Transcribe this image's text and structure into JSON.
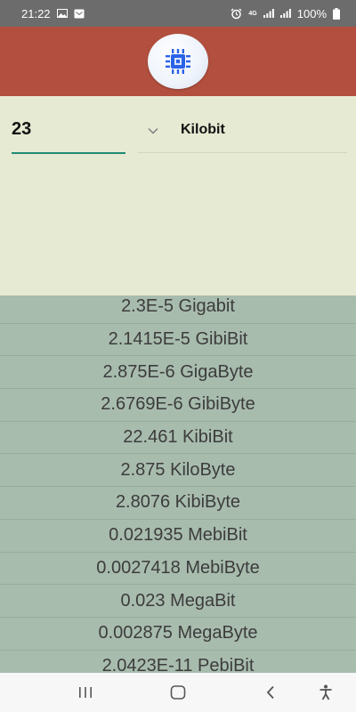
{
  "status_bar": {
    "time": "21:22",
    "network_label": "4G",
    "battery_text": "100%"
  },
  "header": {
    "color": "#b24f3e",
    "logo_icon": "cpu-chip-icon"
  },
  "converter": {
    "input_value": "23",
    "selected_unit": "Kilobit"
  },
  "results": [
    "2.3E-5 Gigabit",
    "2.1415E-5 GibiBit",
    "2.875E-6 GigaByte",
    "2.6769E-6 GibiByte",
    "22.461 KibiBit",
    "2.875 KiloByte",
    "2.8076 KibiByte",
    "0.021935 MebiBit",
    "0.0027418 MebiByte",
    "0.023 MegaBit",
    "0.002875 MegaByte",
    "2.0423E-11 PebiBit"
  ],
  "colors": {
    "accent": "#1f8a74",
    "input_bg": "#e7ead2",
    "results_bg": "#a8bcae"
  },
  "nav_icons": [
    "recent-apps-icon",
    "home-icon",
    "back-icon",
    "accessibility-icon"
  ]
}
